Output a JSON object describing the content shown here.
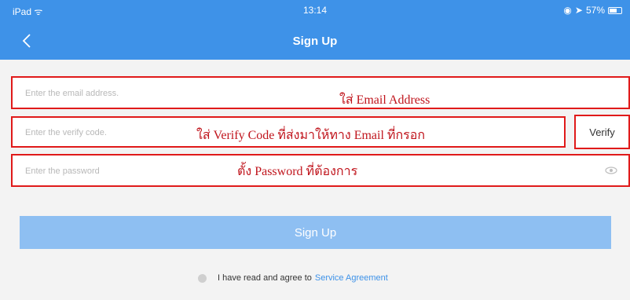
{
  "status_bar": {
    "device": "iPad ᯤ",
    "time": "13:14",
    "battery": "57%"
  },
  "header": {
    "back_icon": "chevron-left-icon",
    "title": "Sign Up"
  },
  "form": {
    "email": {
      "placeholder": "Enter the email address.",
      "value": ""
    },
    "verify_code": {
      "placeholder": "Enter the verify code.",
      "value": ""
    },
    "verify_label": "Verify",
    "password": {
      "placeholder": "Enter the password",
      "value": ""
    }
  },
  "annotations": {
    "email": "ใส่ Email Address",
    "verify": "ใส่ Verify Code ที่ส่งมาให้ทาง Email ที่กรอก",
    "password": "ตั้ง Password ที่ต้องการ"
  },
  "signup_button": "Sign Up",
  "agreement": {
    "text": "I have read and agree to",
    "link": "Service Agreement"
  },
  "colors": {
    "header": "#3e92e8",
    "button_disabled": "#8ebff2",
    "annotation": "#c0141c",
    "link": "#3e92e8"
  }
}
